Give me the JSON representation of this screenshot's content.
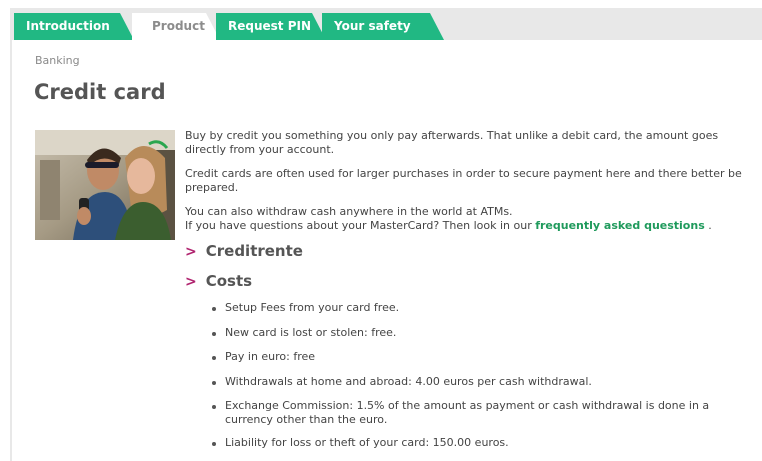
{
  "tabs": [
    {
      "label": "Introduction",
      "active": false
    },
    {
      "label": "Product",
      "active": true
    },
    {
      "label": "Request PIN",
      "active": false
    },
    {
      "label": "Your safety",
      "active": false
    }
  ],
  "breadcrumb": "Banking",
  "page_title": "Credit card",
  "intro": {
    "p1": "Buy by credit you something you only pay afterwards. That unlike a debit card, the amount goes directly from your account.",
    "p2": "Credit cards are often used for larger purchases in order to secure payment here and there better be prepared.",
    "p3_line1": "You can also withdraw cash anywhere in the world at ATMs.",
    "p3_line2": "If you have questions about your MasterCard? Then look in our ",
    "faq_link": "frequently asked questions",
    "p3_end": " ."
  },
  "sections": [
    {
      "label": "Creditrente",
      "chevron": ">"
    },
    {
      "label": "Costs",
      "chevron": ">"
    }
  ],
  "costs": [
    "Setup Fees from your card free.",
    "New card is lost or stolen: free.",
    "Pay in euro: free",
    "Withdrawals at home and abroad: 4.00 euros per cash withdrawal.",
    "Exchange Commission: 1.5% of the amount as payment or cash withdrawal is done in a currency other than the euro.",
    "Liability for loss or theft of your card: 150.00 euros."
  ],
  "colors": {
    "tab_green": "#21b883",
    "link_green": "#1f9a5c",
    "chevron": "#b0226e",
    "topbar": "#e8e8e8"
  }
}
